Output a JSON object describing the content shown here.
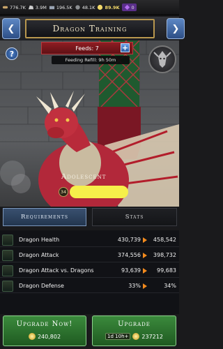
{
  "resources": [
    {
      "name": "wood",
      "value": "776.7K",
      "color": "#c8a46a"
    },
    {
      "name": "stone",
      "value": "3.9M",
      "color": "#cfcfcf"
    },
    {
      "name": "iron",
      "value": "196.5K",
      "color": "#9aa4b3"
    },
    {
      "name": "food",
      "value": "48.1K",
      "color": "#8c8f92"
    },
    {
      "name": "gold",
      "value": "89.9K",
      "color": "#f3d96a"
    },
    {
      "name": "gems",
      "value": "0",
      "color": "#b46df0"
    }
  ],
  "header": {
    "title": "Dragon Training",
    "back_icon": "chevron-left-icon",
    "next_icon": "chevron-right-icon"
  },
  "feeding": {
    "feeds_label": "Feeds: 7",
    "refill_label": "Feeding Refill: 9h 50m"
  },
  "dragon": {
    "age_label": "Adolescent",
    "level": "34"
  },
  "tabs": {
    "requirements": "Requirements",
    "stats": "Stats"
  },
  "stats": [
    {
      "label": "Dragon Health",
      "current": "430,739",
      "next": "458,542"
    },
    {
      "label": "Dragon Attack",
      "current": "374,556",
      "next": "398,732"
    },
    {
      "label": "Dragon Attack vs. Dragons",
      "current": "93,639",
      "next": "99,683"
    },
    {
      "label": "Dragon Defense",
      "current": "33%",
      "next": "34%"
    }
  ],
  "buttons": {
    "upgrade_now": {
      "label": "Upgrade Now!",
      "cost": "240,802"
    },
    "upgrade": {
      "label": "Upgrade",
      "time": "1d 10h+",
      "cost": "237212"
    }
  },
  "colors": {
    "accent_orange": "#f28a1d",
    "button_green": "#2e7a30",
    "banner_red": "#8e1d22"
  }
}
